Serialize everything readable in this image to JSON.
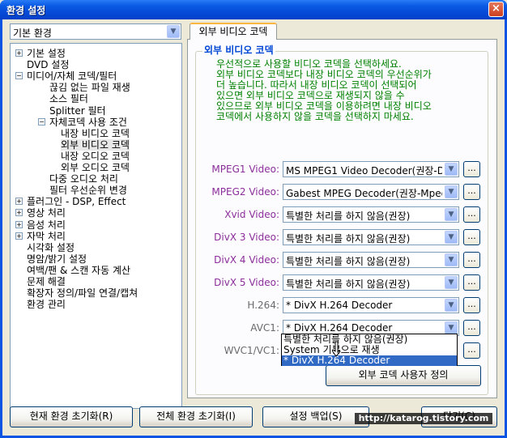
{
  "window": {
    "title": "환경 설정",
    "close_glyph": "×"
  },
  "profile": {
    "selected": "기본 환경"
  },
  "tree": [
    {
      "label": "기본 설정",
      "expander": "+"
    },
    {
      "label": "DVD 설정",
      "expander": ""
    },
    {
      "label": "미디어/자체 코덱/필터",
      "expander": "−"
    },
    {
      "label": "끊김 없는 파일 재생",
      "expander": ""
    },
    {
      "label": "소스 필터",
      "expander": ""
    },
    {
      "label": "Splitter 필터",
      "expander": ""
    },
    {
      "label": "자체코덱 사용 조건",
      "expander": "−"
    },
    {
      "label": "내장 비디오 코덱",
      "expander": ""
    },
    {
      "label": "외부 비디오 코덱",
      "expander": ""
    },
    {
      "label": "내장 오디오 코덱",
      "expander": ""
    },
    {
      "label": "외부 오디오 코덱",
      "expander": ""
    },
    {
      "label": "다중 오디오 처리",
      "expander": ""
    },
    {
      "label": "필터 우선순위 변경",
      "expander": ""
    },
    {
      "label": "플러그인 - DSP, Effect",
      "expander": "+"
    },
    {
      "label": "영상 처리",
      "expander": "+"
    },
    {
      "label": "음성 처리",
      "expander": "+"
    },
    {
      "label": "자막 처리",
      "expander": "+"
    },
    {
      "label": "시각화 설정",
      "expander": ""
    },
    {
      "label": "명암/밝기 설정",
      "expander": ""
    },
    {
      "label": "여백/팬 & 스캔 자동 계산",
      "expander": ""
    },
    {
      "label": "문제 해결",
      "expander": ""
    },
    {
      "label": "확장자 정의/파일 연결/캡쳐",
      "expander": ""
    },
    {
      "label": "환경 관리",
      "expander": ""
    }
  ],
  "panel": {
    "tab_label": "외부 비디오 코덱",
    "group_title": "외부 비디오 코덱",
    "description": [
      "우선적으로 사용할 비디오 코덱을 선택하세요.",
      "외부 비디오 코덱보다 내장 비디오 코덱의 우선순위가",
      "더 높습니다. 따라서 내장 비디오 코덱이 선택되어",
      "있으면 외부 비디오 코덱으로 재생되지 않을 수",
      "있으므로 외부 비디오 코덱을 이용하려면 내장 비디오",
      "코덱에서 사용하지 않을 코덱을 선택하지 마세요."
    ],
    "codecs": [
      {
        "label": "MPEG1 Video:",
        "value": "MS MPEG1 Video Decoder(권장-Di"
      },
      {
        "label": "MPEG2 Video:",
        "value": "Gabest MPEG Decoder(권장-Mpeg"
      },
      {
        "label": "Xvid Video:",
        "value": "특별한 처리를 하지 않음(권장)"
      },
      {
        "label": "DivX 3 Video:",
        "value": "특별한 처리를 하지 않음(권장)"
      },
      {
        "label": "DivX 4 Video:",
        "value": "특별한 처리를 하지 않음(권장)"
      },
      {
        "label": "DivX 5 Video:",
        "value": "특별한 처리를 하지 않음(권장)"
      },
      {
        "label": "H.264:",
        "value": "* DivX H.264 Decoder"
      },
      {
        "label": "AVC1:",
        "value": "* DivX H.264 Decoder"
      },
      {
        "label": "WVC1/VC1:",
        "value": ""
      }
    ],
    "dots_label": "...",
    "dropdown_options": [
      "특별한 처리를 하지 않음(권장)",
      "System 기본으로 재생",
      "* DivX H.264 Decoder"
    ],
    "custom_codec_button": "외부 코덱 사용자 정의"
  },
  "footer": {
    "reset_current": "현재 환경 초기화(R)",
    "reset_all": "전체 환경 초기화(I)",
    "backup": "설정 백업(S)",
    "close": "닫기(C)"
  },
  "watermark": "http://katarog.tistory.com",
  "colors": {
    "title_bar": "#0a54e3",
    "label_purple": "#8b2d9a",
    "description_green": "#008000",
    "group_title_blue": "#0046d5",
    "selection": "#316ac5"
  }
}
